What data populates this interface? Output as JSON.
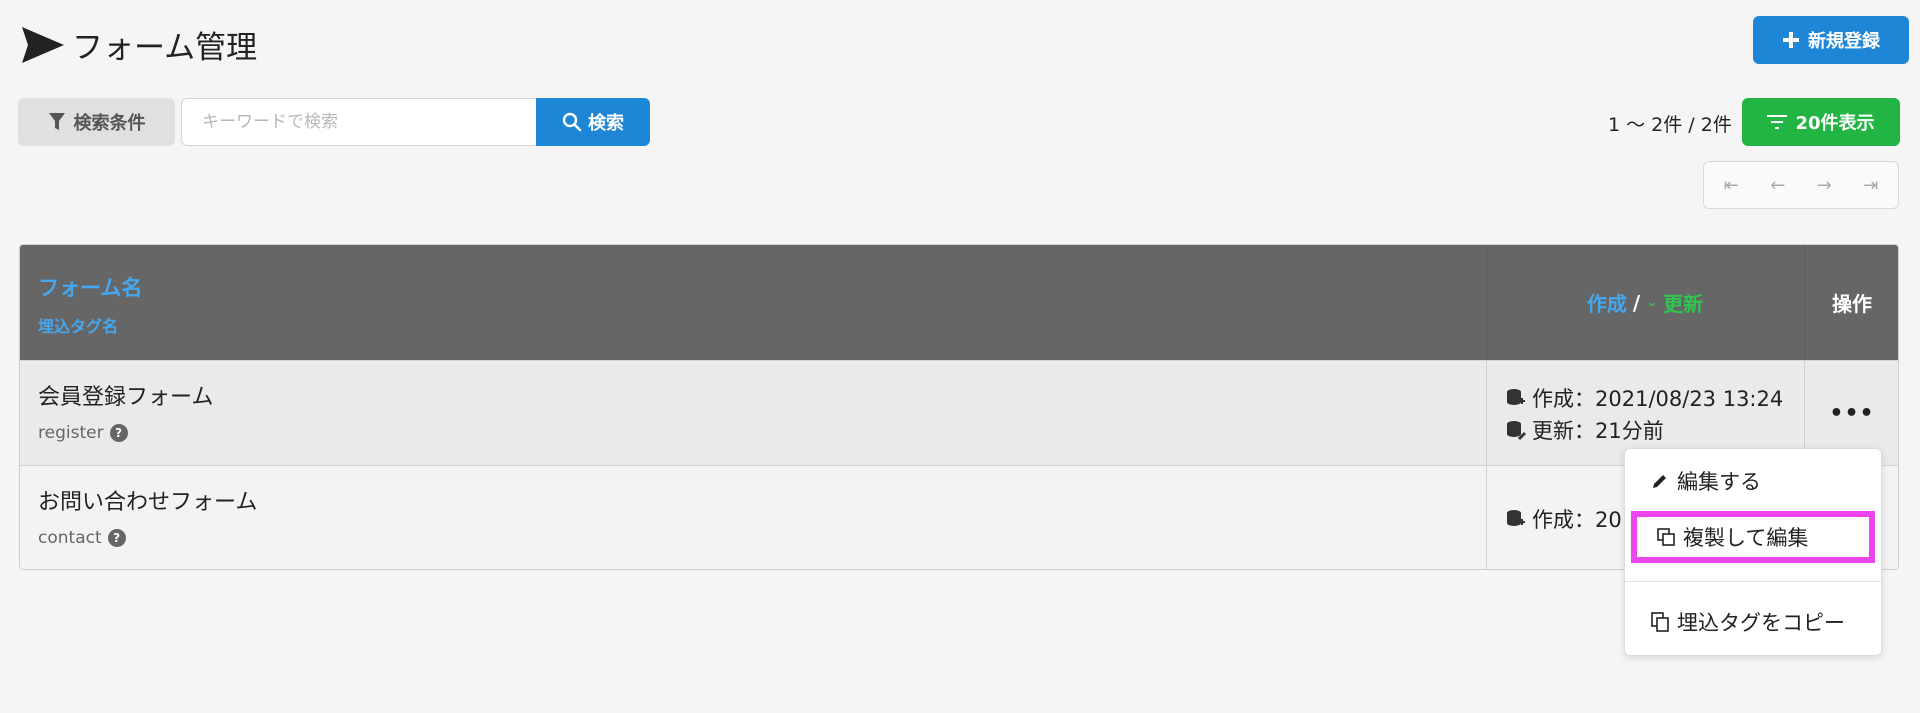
{
  "header": {
    "title": "フォーム管理",
    "new_button": "新規登録",
    "icon": "paper-plane-icon"
  },
  "search": {
    "conditions_button": "検索条件",
    "placeholder": "キーワードで検索",
    "value": "",
    "search_button": "検索"
  },
  "pagination": {
    "count_text": "1 〜 2件 / 2件",
    "per_page_button": "20件表示",
    "first_icon": "⇤",
    "prev_icon": "←",
    "next_icon": "→",
    "last_icon": "⇥"
  },
  "table": {
    "headers": {
      "name": "フォーム名",
      "tag": "埋込タグ名",
      "created": "作成",
      "separator": "/",
      "updated": "更新",
      "operations": "操作"
    },
    "rows": [
      {
        "name": "会員登録フォーム",
        "tag": "register",
        "created": "作成：2021/08/23 13:24",
        "updated": "更新：21分前",
        "ops": "•••"
      },
      {
        "name": "お問い合わせフォーム",
        "tag": "contact",
        "created": "作成：20",
        "ops": ""
      }
    ]
  },
  "menu": {
    "items": [
      {
        "label": "編集する",
        "icon": "pencil-icon"
      },
      {
        "label": "複製して編集",
        "icon": "copy-edit-icon"
      },
      {
        "label": "埋込タグをコピー",
        "icon": "copy-icon"
      }
    ]
  },
  "colors": {
    "primary": "#1e86d6",
    "success": "#22b544",
    "header_bg": "#666666",
    "link_blue": "#45a7f0",
    "link_green": "#2fc54f",
    "highlight": "#ee44ee"
  }
}
